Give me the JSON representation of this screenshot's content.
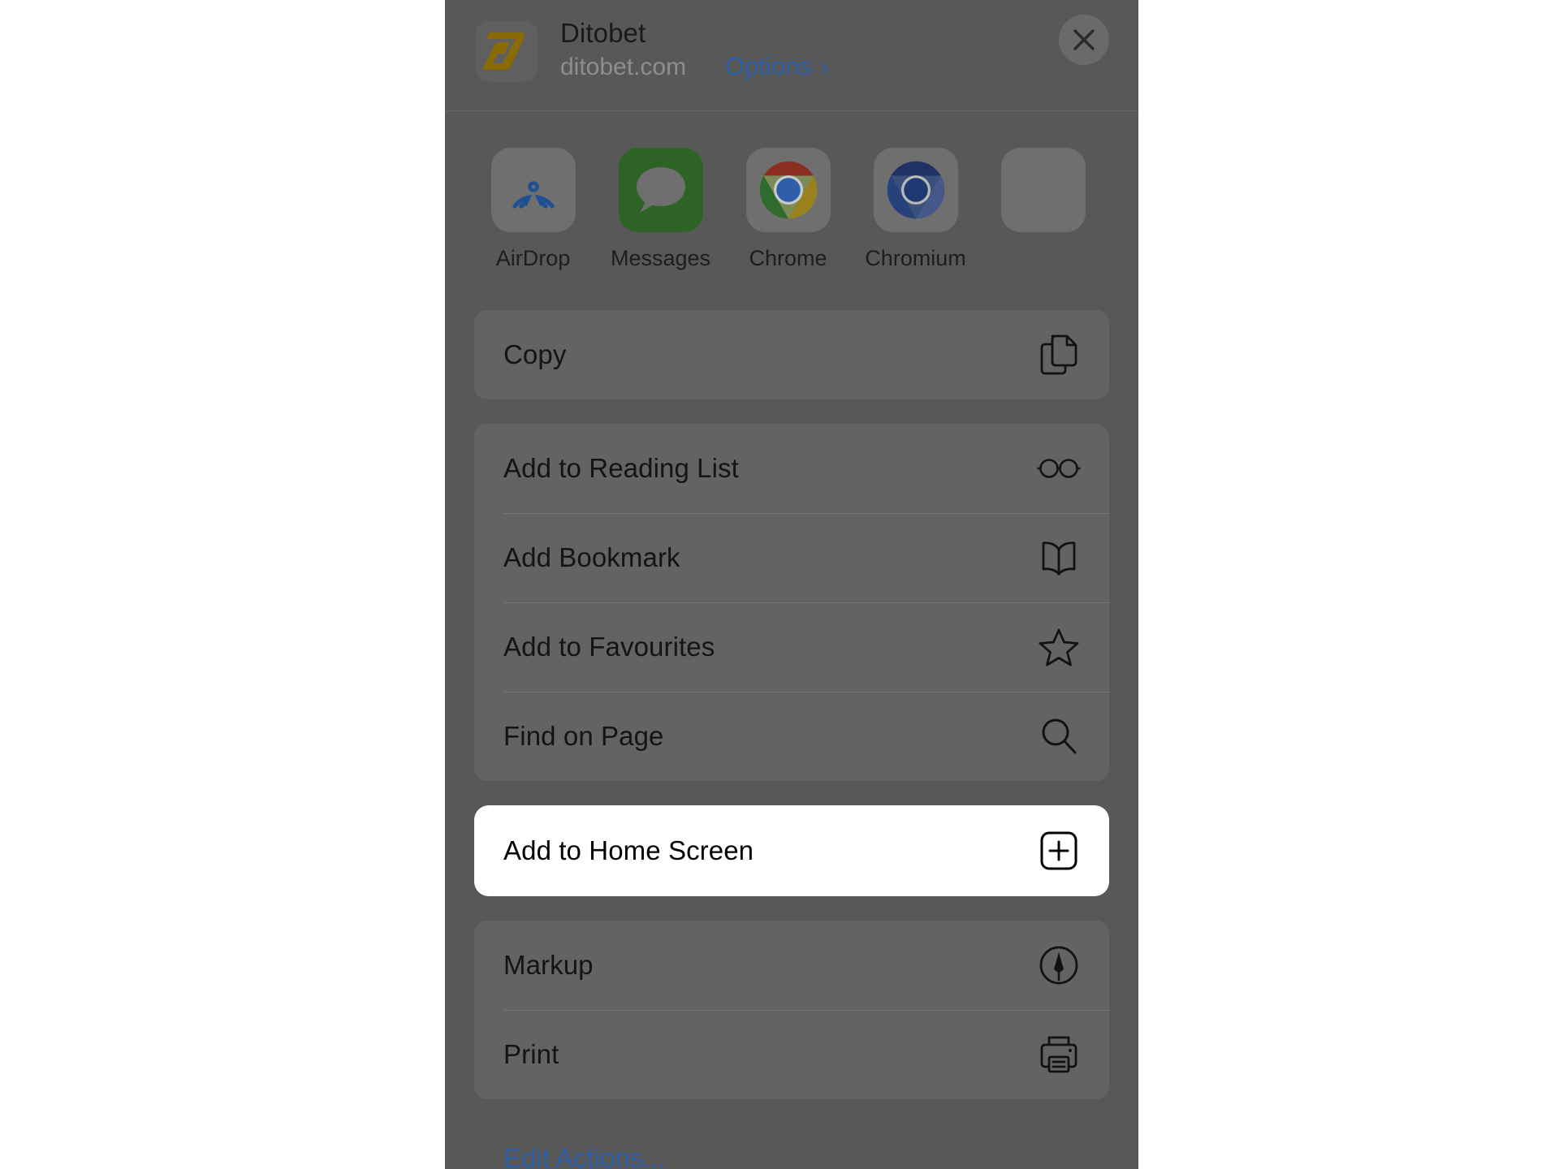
{
  "sheet": {
    "site": {
      "title": "Ditobet",
      "url": "ditobet.com",
      "options_label": "Options",
      "options_chevron": "›",
      "favicon_color": "#8a6a05"
    },
    "close_label": "×",
    "apps": [
      {
        "label": "AirDrop",
        "icon": "airdrop-icon"
      },
      {
        "label": "Messages",
        "icon": "messages-icon"
      },
      {
        "label": "Chrome",
        "icon": "chrome-icon"
      },
      {
        "label": "Chromium",
        "icon": "chromium-icon"
      },
      {
        "label": "",
        "icon": "more-apps-icon"
      }
    ],
    "groups": [
      {
        "highlighted": false,
        "items": [
          {
            "label": "Copy",
            "icon": "copy-documents-icon"
          }
        ]
      },
      {
        "highlighted": false,
        "items": [
          {
            "label": "Add to Reading List",
            "icon": "glasses-icon"
          },
          {
            "label": "Add Bookmark",
            "icon": "open-book-icon"
          },
          {
            "label": "Add to Favourites",
            "icon": "star-icon"
          },
          {
            "label": "Find on Page",
            "icon": "magnifier-icon"
          }
        ]
      },
      {
        "highlighted": true,
        "items": [
          {
            "label": "Add to Home Screen",
            "icon": "plus-square-icon"
          }
        ]
      },
      {
        "highlighted": false,
        "items": [
          {
            "label": "Markup",
            "icon": "markup-pen-icon"
          },
          {
            "label": "Print",
            "icon": "printer-icon"
          }
        ]
      }
    ],
    "edit_actions_label": "Edit Actions...",
    "colors": {
      "dim_overlay": "#585858",
      "group_background": "#636363",
      "highlight_background": "#ffffff",
      "link_blue": "#2a5ea8",
      "text_primary": "#141414",
      "text_secondary": "#8e8e8e"
    }
  }
}
